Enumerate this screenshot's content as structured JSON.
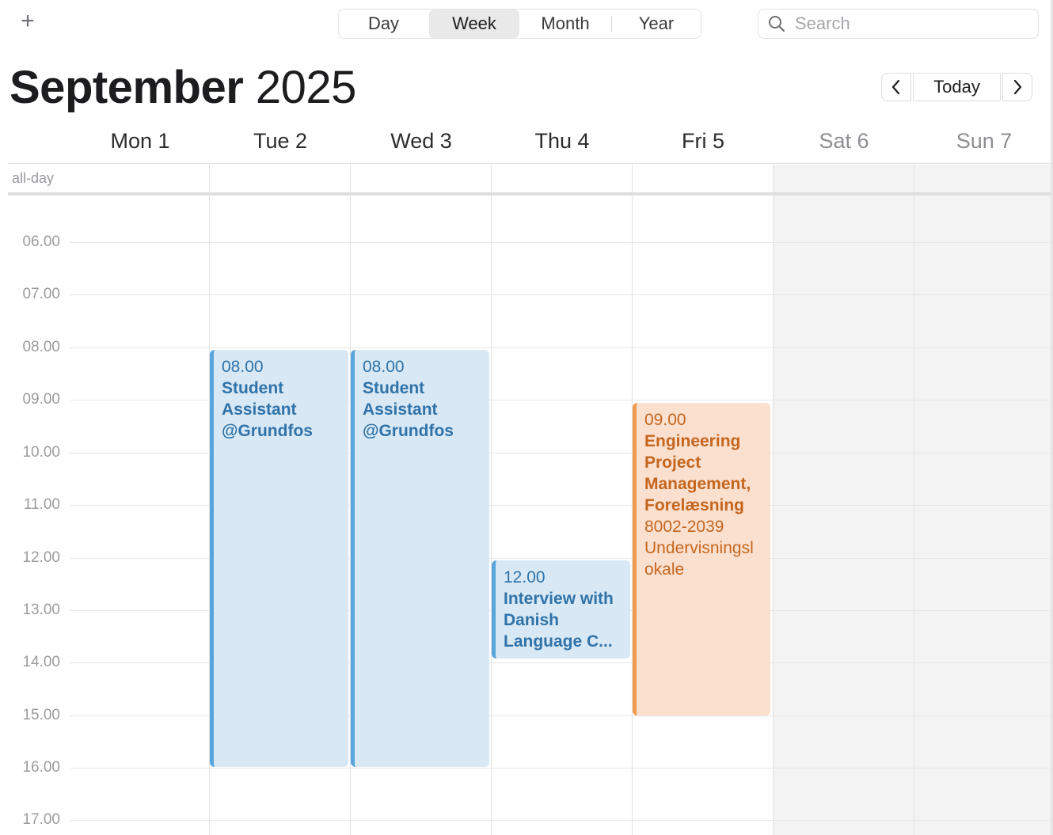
{
  "toolbar": {
    "add_label": "+",
    "views": [
      "Day",
      "Week",
      "Month",
      "Year"
    ],
    "active_view": "Week",
    "search_placeholder": "Search"
  },
  "header": {
    "month": "September",
    "year": "2025"
  },
  "nav": {
    "today_label": "Today"
  },
  "days": [
    {
      "label": "Mon 1",
      "weekend": false
    },
    {
      "label": "Tue 2",
      "weekend": false
    },
    {
      "label": "Wed 3",
      "weekend": false
    },
    {
      "label": "Thu 4",
      "weekend": false
    },
    {
      "label": "Fri 5",
      "weekend": false
    },
    {
      "label": "Sat 6",
      "weekend": true
    },
    {
      "label": "Sun 7",
      "weekend": true
    }
  ],
  "allday_label": "all-day",
  "hours": [
    "06.00",
    "07.00",
    "08.00",
    "09.00",
    "10.00",
    "11.00",
    "12.00",
    "13.00",
    "14.00",
    "15.00",
    "16.00",
    "17.00"
  ],
  "events": [
    {
      "day": "Tue 2",
      "start": "08.00",
      "end": "16.00",
      "time": "08.00",
      "title_lines": [
        "Student",
        "Assistant",
        "@Grundfos"
      ],
      "location_lines": [],
      "color": "#58a6dc"
    },
    {
      "day": "Wed 3",
      "start": "08.00",
      "end": "16.00",
      "time": "08.00",
      "title_lines": [
        "Student",
        "Assistant",
        "@Grundfos"
      ],
      "location_lines": [],
      "color": "#58a6dc"
    },
    {
      "day": "Thu 4",
      "start": "12.00",
      "end": "13.30",
      "time": "12.00",
      "title_lines": [
        "Interview with",
        "Danish",
        "Language C..."
      ],
      "location_lines": [],
      "color": "#58a6dc"
    },
    {
      "day": "Fri 5",
      "start": "09.00",
      "end": "15.00",
      "time": "09.00",
      "title_lines": [
        "Engineering",
        "Project",
        "Management,",
        "Forelæsning"
      ],
      "location_lines": [
        "8002-2039",
        "Undervisningsl",
        "okale"
      ],
      "color": "#ed9b4d"
    }
  ]
}
